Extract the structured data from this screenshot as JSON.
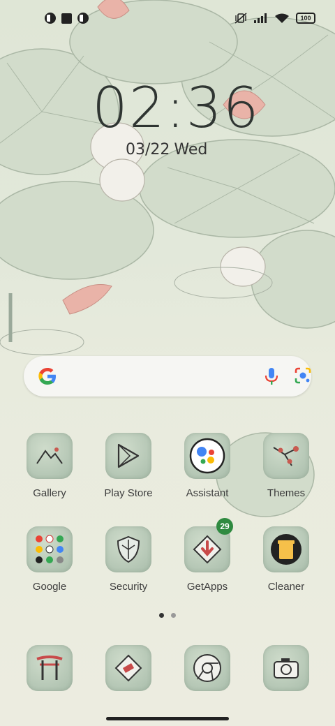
{
  "status_bar": {
    "battery": "100",
    "left_icons": [
      "notification-icon",
      "square-icon",
      "notification-icon"
    ],
    "right_icons": [
      "vibrate-off-icon",
      "signal-icon",
      "wifi-icon",
      "battery-icon"
    ]
  },
  "lockclock": {
    "time": "02:36",
    "date": "03/22",
    "weekday": "Wed"
  },
  "search_bar": {
    "icons": [
      "google-logo-icon",
      "mic-icon",
      "lens-icon"
    ]
  },
  "home": {
    "row1": [
      {
        "label": "Gallery",
        "icon": "mountains-icon"
      },
      {
        "label": "Play Store",
        "icon": "play-icon"
      },
      {
        "label": "Assistant",
        "icon": "assistant-icon"
      },
      {
        "label": "Themes",
        "icon": "plum-blossom-icon"
      }
    ],
    "row2": [
      {
        "label": "Google",
        "icon": "folder-icon"
      },
      {
        "label": "Security",
        "icon": "shield-icon"
      },
      {
        "label": "GetApps",
        "icon": "download-arrow-icon",
        "badge": "29"
      },
      {
        "label": "Cleaner",
        "icon": "trash-icon"
      }
    ],
    "dock": [
      {
        "icon": "torii-gate-icon"
      },
      {
        "icon": "messages-icon"
      },
      {
        "icon": "chrome-icon"
      },
      {
        "icon": "camera-icon"
      }
    ]
  },
  "page_indicator": {
    "pages": 2,
    "current": 1
  },
  "colors": {
    "icon_bg": "#a8bcaa",
    "badge": "#2f8a40",
    "wallpaper": "#e2e8da"
  }
}
